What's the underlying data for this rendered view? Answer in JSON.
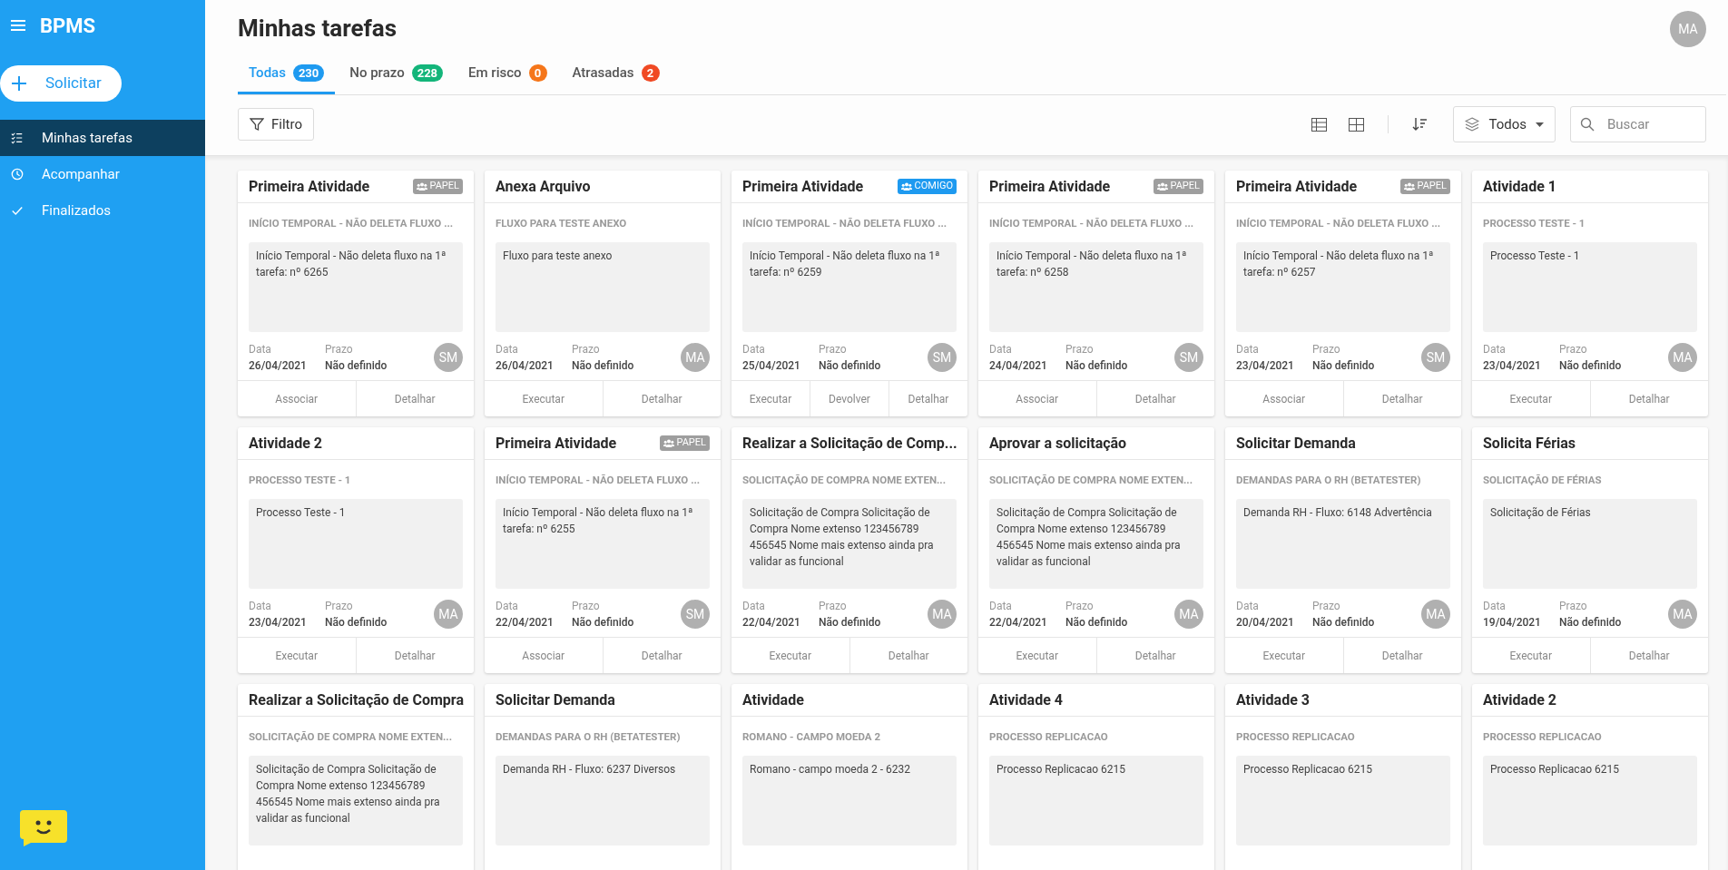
{
  "app": {
    "title": "BPMS"
  },
  "sidebar": {
    "action": "Solicitar",
    "items": [
      {
        "label": "Minhas tarefas",
        "kind": "tasks",
        "selected": true
      },
      {
        "label": "Acompanhar",
        "kind": "tracking",
        "selected": false
      },
      {
        "label": "Finalizados",
        "kind": "finished",
        "selected": false
      }
    ]
  },
  "header": {
    "title": "Minhas tarefas",
    "user_initials": "MA"
  },
  "tabs": [
    {
      "label": "Todas",
      "count": "230",
      "color": "#1e9af0",
      "selected": true
    },
    {
      "label": "No prazo",
      "count": "228",
      "color": "#13b57a",
      "selected": false
    },
    {
      "label": "Em risco",
      "count": "0",
      "color": "#f5761a",
      "selected": false
    },
    {
      "label": "Atrasadas",
      "count": "2",
      "color": "#f04a24",
      "selected": false
    }
  ],
  "toolbar": {
    "filter": "Filtro",
    "scope": "Todos",
    "search": {
      "placeholder": "Buscar"
    }
  },
  "cards": [
    {
      "title": "Primeira Atividade",
      "badge": {
        "label": "PAPEL",
        "kind": "role"
      },
      "process": "INÍCIO TEMPORAL - NÃO DELETA FLUXO ...",
      "description": "Início Temporal - Não deleta fluxo na 1ª tarefa: nº 6265",
      "date_label": "Data",
      "date": "26/04/2021",
      "deadline_label": "Prazo",
      "deadline": "Não definido",
      "assignee": "SM",
      "actions": [
        "Associar",
        "Detalhar"
      ]
    },
    {
      "title": "Anexa Arquivo",
      "process": "FLUXO PARA TESTE ANEXO",
      "description": "Fluxo para teste anexo",
      "date_label": "Data",
      "date": "26/04/2021",
      "deadline_label": "Prazo",
      "deadline": "Não definido",
      "assignee": "MA",
      "actions": [
        "Executar",
        "Detalhar"
      ]
    },
    {
      "title": "Primeira Atividade",
      "badge": {
        "label": "COMIGO",
        "kind": "mine"
      },
      "process": "INÍCIO TEMPORAL - NÃO DELETA FLUXO ...",
      "description": "Início Temporal - Não deleta fluxo na 1ª tarefa: nº 6259",
      "date_label": "Data",
      "date": "25/04/2021",
      "deadline_label": "Prazo",
      "deadline": "Não definido",
      "assignee": "SM",
      "actions": [
        "Executar",
        "Devolver",
        "Detalhar"
      ]
    },
    {
      "title": "Primeira Atividade",
      "badge": {
        "label": "PAPEL",
        "kind": "role"
      },
      "process": "INÍCIO TEMPORAL - NÃO DELETA FLUXO ...",
      "description": "Início Temporal - Não deleta fluxo na 1ª tarefa: nº 6258",
      "date_label": "Data",
      "date": "24/04/2021",
      "deadline_label": "Prazo",
      "deadline": "Não definido",
      "assignee": "SM",
      "actions": [
        "Associar",
        "Detalhar"
      ]
    },
    {
      "title": "Primeira Atividade",
      "badge": {
        "label": "PAPEL",
        "kind": "role"
      },
      "process": "INÍCIO TEMPORAL - NÃO DELETA FLUXO ...",
      "description": "Início Temporal - Não deleta fluxo na 1ª tarefa: nº 6257",
      "date_label": "Data",
      "date": "23/04/2021",
      "deadline_label": "Prazo",
      "deadline": "Não definido",
      "assignee": "SM",
      "actions": [
        "Associar",
        "Detalhar"
      ]
    },
    {
      "title": "Atividade 1",
      "process": "PROCESSO TESTE - 1",
      "description": "Processo Teste - 1",
      "date_label": "Data",
      "date": "23/04/2021",
      "deadline_label": "Prazo",
      "deadline": "Não definido",
      "assignee": "MA",
      "actions": [
        "Executar",
        "Detalhar"
      ]
    },
    {
      "title": "Atividade 2",
      "process": "PROCESSO TESTE - 1",
      "description": "Processo Teste - 1",
      "date_label": "Data",
      "date": "23/04/2021",
      "deadline_label": "Prazo",
      "deadline": "Não definido",
      "assignee": "MA",
      "actions": [
        "Executar",
        "Detalhar"
      ]
    },
    {
      "title": "Primeira Atividade",
      "badge": {
        "label": "PAPEL",
        "kind": "role"
      },
      "process": "INÍCIO TEMPORAL - NÃO DELETA FLUXO ...",
      "description": "Início Temporal - Não deleta fluxo na 1ª tarefa: nº 6255",
      "date_label": "Data",
      "date": "22/04/2021",
      "deadline_label": "Prazo",
      "deadline": "Não definido",
      "assignee": "SM",
      "actions": [
        "Associar",
        "Detalhar"
      ]
    },
    {
      "title": "Realizar a Solicitação de Comp...",
      "process": "SOLICITAÇÃO DE COMPRA NOME EXTEN...",
      "description": "Solicitação de Compra Solicitação de Compra Nome extenso 123456789 456545 Nome mais extenso ainda pra validar as funcional",
      "date_label": "Data",
      "date": "22/04/2021",
      "deadline_label": "Prazo",
      "deadline": "Não definido",
      "assignee": "MA",
      "actions": [
        "Executar",
        "Detalhar"
      ]
    },
    {
      "title": "Aprovar a solicitação",
      "process": "SOLICITAÇÃO DE COMPRA NOME EXTEN...",
      "description": "Solicitação de Compra Solicitação de Compra Nome extenso 123456789 456545 Nome mais extenso ainda pra validar as funcional",
      "date_label": "Data",
      "date": "22/04/2021",
      "deadline_label": "Prazo",
      "deadline": "Não definido",
      "assignee": "MA",
      "actions": [
        "Executar",
        "Detalhar"
      ]
    },
    {
      "title": "Solicitar Demanda",
      "process": "DEMANDAS PARA O RH (BETATESTER)",
      "description": "Demanda RH - Fluxo: 6148 Advertência",
      "date_label": "Data",
      "date": "20/04/2021",
      "deadline_label": "Prazo",
      "deadline": "Não definido",
      "assignee": "MA",
      "actions": [
        "Executar",
        "Detalhar"
      ]
    },
    {
      "title": "Solicita Férias",
      "process": "SOLICITAÇÃO DE FÉRIAS",
      "description": "Solicitação de Férias",
      "date_label": "Data",
      "date": "19/04/2021",
      "deadline_label": "Prazo",
      "deadline": "Não definido",
      "assignee": "MA",
      "actions": [
        "Executar",
        "Detalhar"
      ]
    },
    {
      "title": "Realizar a Solicitação de Compra",
      "process": "SOLICITAÇÃO DE COMPRA NOME EXTEN...",
      "description": "Solicitação de Compra Solicitação de Compra Nome extenso 123456789 456545 Nome mais extenso ainda pra validar as funcional"
    },
    {
      "title": "Solicitar Demanda",
      "process": "DEMANDAS PARA O RH (BETATESTER)",
      "description": "Demanda RH - Fluxo: 6237 Diversos"
    },
    {
      "title": "Atividade",
      "process": "ROMANO - CAMPO MOEDA 2",
      "description": "Romano - campo moeda 2 - 6232"
    },
    {
      "title": "Atividade 4",
      "process": "PROCESSO REPLICACAO",
      "description": "Processo Replicacao 6215"
    },
    {
      "title": "Atividade 3",
      "process": "PROCESSO REPLICACAO",
      "description": "Processo Replicacao 6215"
    },
    {
      "title": "Atividade 2",
      "process": "PROCESSO REPLICACAO",
      "description": "Processo Replicacao 6215"
    }
  ]
}
